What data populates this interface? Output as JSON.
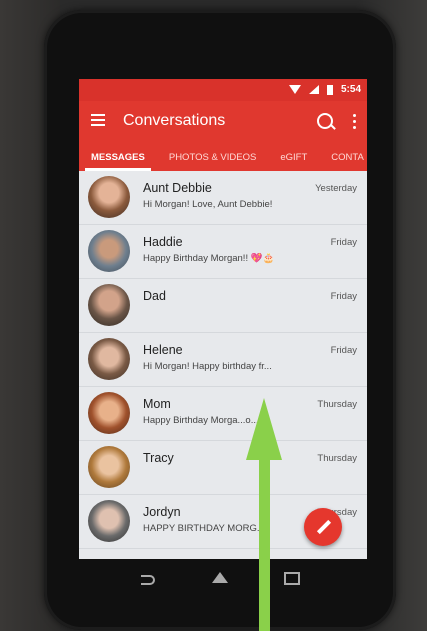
{
  "status_bar": {
    "time": "5:54"
  },
  "app_bar": {
    "title": "Conversations"
  },
  "tabs": [
    {
      "label": "MESSAGES",
      "active": true
    },
    {
      "label": "PHOTOS & VIDEOS",
      "active": false
    },
    {
      "label": "eGIFT",
      "active": false
    },
    {
      "label": "CONTA",
      "active": false
    }
  ],
  "conversations": [
    {
      "name": "Aunt Debbie",
      "snippet": "Hi Morgan! Love, Aunt Debbie!",
      "time": "Yesterday"
    },
    {
      "name": "Haddie",
      "snippet": "Happy Birthday Morgan!! 💖🎂",
      "time": "Friday"
    },
    {
      "name": "Dad",
      "snippet": "",
      "time": "Friday"
    },
    {
      "name": "Helene",
      "snippet": "Hi Morgan! Happy birthday fr...",
      "time": "Friday"
    },
    {
      "name": "Mom",
      "snippet": "Happy Birthday Morga...o...",
      "time": "Thursday"
    },
    {
      "name": "Tracy",
      "snippet": "",
      "time": "Thursday"
    },
    {
      "name": "Jordyn",
      "snippet": "HAPPY BIRTHDAY MORG...",
      "time": "Thursday"
    }
  ],
  "colors": {
    "accent": "#e0382f",
    "arrow": "#8ad04a"
  },
  "icons": [
    "menu-icon",
    "search-icon",
    "more-vert-icon",
    "pencil-icon",
    "back-icon",
    "home-icon",
    "recent-apps-icon"
  ]
}
